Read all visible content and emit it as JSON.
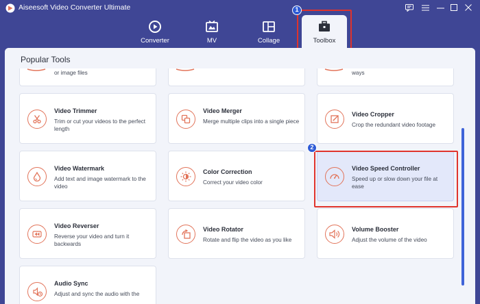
{
  "app": {
    "title": "Aiseesoft Video Converter Ultimate"
  },
  "window_controls": [
    "feedback-icon",
    "menu-icon",
    "minimize-icon",
    "maximize-icon",
    "close-icon"
  ],
  "nav": {
    "tabs": [
      {
        "label": "Converter",
        "icon": "converter-icon"
      },
      {
        "label": "MV",
        "icon": "mv-icon"
      },
      {
        "label": "Collage",
        "icon": "collage-icon"
      },
      {
        "label": "Toolbox",
        "icon": "toolbox-icon",
        "active": true
      }
    ]
  },
  "steps": {
    "one": "1",
    "two": "2"
  },
  "section": {
    "title": "Popular Tools"
  },
  "partial_cards": {
    "left_desc": "or image files",
    "right_desc": "ways"
  },
  "tools": [
    {
      "title": "Video Trimmer",
      "desc": "Trim or cut your videos to the perfect length",
      "icon": "scissors-icon"
    },
    {
      "title": "Video Merger",
      "desc": "Merge multiple clips into a single piece",
      "icon": "merge-icon"
    },
    {
      "title": "Video Cropper",
      "desc": "Crop the redundant video footage",
      "icon": "crop-icon"
    },
    {
      "title": "Video Watermark",
      "desc": "Add text and image watermark to the video",
      "icon": "droplet-icon"
    },
    {
      "title": "Color Correction",
      "desc": "Correct your video color",
      "icon": "sun-icon"
    },
    {
      "title": "Video Speed Controller",
      "desc": "Speed up or slow down your file at ease",
      "icon": "speedometer-icon",
      "selected": true
    },
    {
      "title": "Video Reverser",
      "desc": "Reverse your video and turn it backwards",
      "icon": "rewind-icon"
    },
    {
      "title": "Video Rotator",
      "desc": "Rotate and flip the video as you like",
      "icon": "rotate-icon"
    },
    {
      "title": "Volume Booster",
      "desc": "Adjust the volume of the video",
      "icon": "volume-icon"
    },
    {
      "title": "Audio Sync",
      "desc": "Adjust and sync the audio with the",
      "icon": "audio-sync-icon"
    }
  ],
  "colors": {
    "header_bg": "#3f4695",
    "accent_orange": "#e2745a",
    "highlight_red": "#e0332c",
    "step_blue": "#2e5bd6",
    "selected_card": "#e3e8fa"
  }
}
